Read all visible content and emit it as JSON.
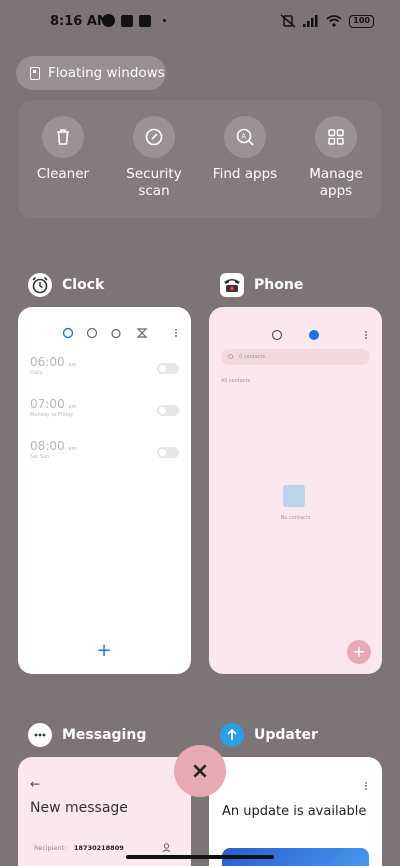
{
  "status": {
    "time": "8:16 AM",
    "battery": "100"
  },
  "floating_windows": "Floating windows",
  "quick_actions": [
    {
      "label_1": "Cleaner",
      "label_2": "",
      "icon": "trash-icon"
    },
    {
      "label_1": "Security",
      "label_2": "scan",
      "icon": "shield-check-icon"
    },
    {
      "label_1": "Find apps",
      "label_2": "",
      "icon": "app-search-icon"
    },
    {
      "label_1": "Manage",
      "label_2": "apps",
      "icon": "grid-icon"
    }
  ],
  "apps": {
    "clock": {
      "name": "Clock",
      "alarms": [
        {
          "time": "06:00",
          "ampm": "am",
          "repeat": "Daily"
        },
        {
          "time": "07:00",
          "ampm": "am",
          "repeat": "Monday to Friday"
        },
        {
          "time": "08:00",
          "ampm": "am",
          "repeat": "Sat Sun"
        }
      ],
      "fab": "+"
    },
    "phone": {
      "name": "Phone",
      "search_placeholder": "0 contacts",
      "filter": "All contacts",
      "empty": "No contacts",
      "fab": "+"
    },
    "messaging": {
      "name": "Messaging",
      "title": "New message",
      "recipient_label": "Recipient:",
      "recipient_value": "18730218809"
    },
    "updater": {
      "name": "Updater",
      "headline": "An update is available"
    }
  },
  "close_label": "×",
  "colors": {
    "background": "#7d7475",
    "accent_blue": "#1a73e8",
    "fab_pink": "#e8a9b6"
  }
}
